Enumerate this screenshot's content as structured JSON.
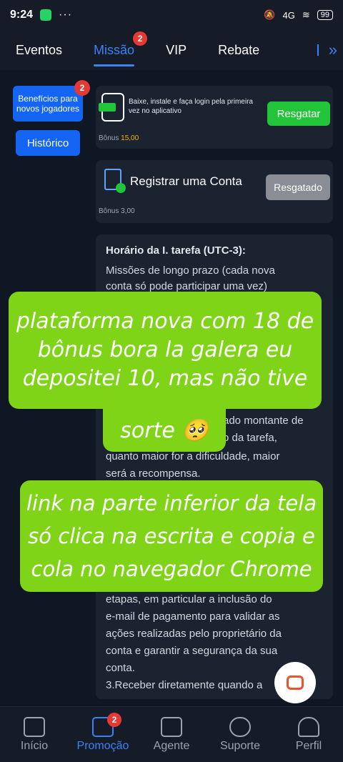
{
  "status": {
    "time": "9:24",
    "dots": "···",
    "network": "4G",
    "battery": "99"
  },
  "tabs": [
    {
      "label": "Eventos"
    },
    {
      "label": "Missão",
      "badge": "2"
    },
    {
      "label": "VIP"
    },
    {
      "label": "Rebate"
    }
  ],
  "sidebar": {
    "beneficios": "Benefícios para novos jogadores",
    "beneficios_badge": "2",
    "historico": "Histórico"
  },
  "tasks": [
    {
      "title": "Baixe, instale e faça login pela primeira vez no aplicativo",
      "bonus_label": "Bônus",
      "bonus": "15,00",
      "button": "Resgatar"
    },
    {
      "title": "Registrar uma Conta",
      "bonus_label": "Bônus",
      "bonus": "3,00",
      "button": "Resgatado"
    }
  ],
  "description": {
    "heading": "Horário da I. tarefa (UTC-3):",
    "l1": "Missões de longo prazo (cada nova",
    "l2": "conta só pode participar uma vez)",
    "l3": "ado montante de",
    "l4": "o da tarefa,",
    "l5": "quanto maior for a dificuldade, maior",
    "l6": "será a recompensa.",
    "l7": "etapas, em particular a inclusão do",
    "l8": "e-mail de pagamento para validar as",
    "l9": "ações realizadas pelo proprietário da",
    "l10": "conta e garantir a segurança da sua",
    "l11": "conta.",
    "l12": "3.Receber diretamente quando a"
  },
  "overlay1": {
    "line1": "plataforma nova com 18 de",
    "line2": "bônus bora la galera eu",
    "line3": "depositei 10, mas não tive",
    "line4": "sorte 🥺"
  },
  "overlay2": {
    "line1": "link na parte inferior da tela",
    "line2": "só clica na escrita e copia e",
    "line3": "cola no navegador Chrome"
  },
  "bottom_nav": [
    {
      "label": "Início"
    },
    {
      "label": "Promoção",
      "badge": "2"
    },
    {
      "label": "Agente"
    },
    {
      "label": "Suporte"
    },
    {
      "label": "Perfil"
    }
  ],
  "colors": {
    "accent": "#1565f5",
    "green_button": "#22c43a",
    "overlay": "#7fd418",
    "badge": "#e53935"
  }
}
